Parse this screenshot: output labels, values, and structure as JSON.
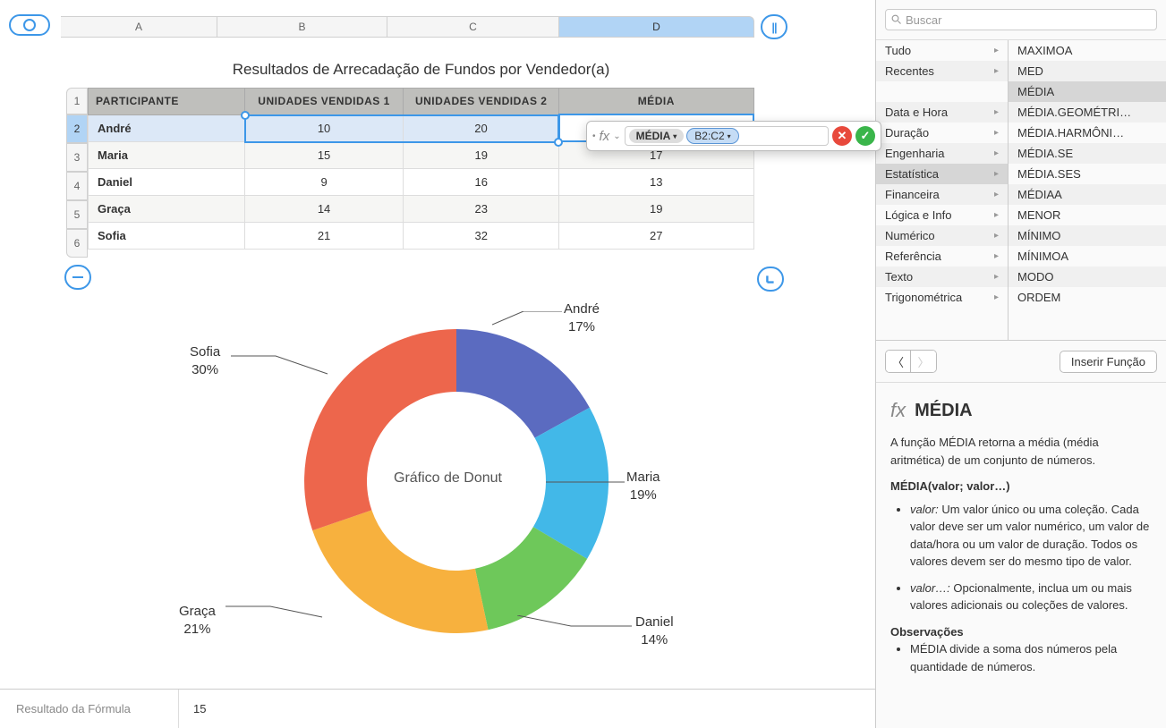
{
  "columns": {
    "A": "A",
    "B": "B",
    "C": "C",
    "D": "D"
  },
  "rows": {
    "1": "1",
    "2": "2",
    "3": "3",
    "4": "4",
    "5": "5",
    "6": "6"
  },
  "title": "Resultados de Arrecadação de Fundos por Vendedor(a)",
  "headers": {
    "participant": "PARTICIPANTE",
    "u1": "UNIDADES VENDIDAS 1",
    "u2": "UNIDADES VENDIDAS 2",
    "avg": "MÉDIA"
  },
  "table": [
    {
      "name": "André",
      "u1": "10",
      "u2": "20",
      "avg": ""
    },
    {
      "name": "Maria",
      "u1": "15",
      "u2": "19",
      "avg": "17"
    },
    {
      "name": "Daniel",
      "u1": "9",
      "u2": "16",
      "avg": "13"
    },
    {
      "name": "Graça",
      "u1": "14",
      "u2": "23",
      "avg": "19"
    },
    {
      "name": "Sofia",
      "u1": "21",
      "u2": "32",
      "avg": "27"
    }
  ],
  "formula_editor": {
    "func": "MÉDIA",
    "range": "B2:C2"
  },
  "chart_data": {
    "type": "pie",
    "title": "Gráfico de Donut",
    "categories": [
      "André",
      "Maria",
      "Daniel",
      "Graça",
      "Sofia"
    ],
    "values": [
      17,
      19,
      14,
      21,
      30
    ],
    "labels": {
      "andre_name": "André",
      "andre_pct": "17%",
      "maria_name": "Maria",
      "maria_pct": "19%",
      "daniel_name": "Daniel",
      "daniel_pct": "14%",
      "graca_name": "Graça",
      "graca_pct": "21%",
      "sofia_name": "Sofia",
      "sofia_pct": "30%"
    },
    "colors": {
      "andre": "#5b6bc0",
      "maria": "#42b8e8",
      "daniel": "#6ec85a",
      "graca": "#f7b13e",
      "sofia": "#ed664c"
    }
  },
  "bottom_bar": {
    "label": "Resultado da Fórmula",
    "value": "15"
  },
  "sidebar": {
    "search_placeholder": "Buscar",
    "categories": [
      "Tudo",
      "Recentes",
      "",
      "Data e Hora",
      "Duração",
      "Engenharia",
      "Estatística",
      "Financeira",
      "Lógica e Info",
      "Numérico",
      "Referência",
      "Texto",
      "Trigonométrica"
    ],
    "category_selected": "Estatística",
    "functions": [
      "MAXIMOA",
      "MED",
      "MÉDIA",
      "MÉDIA.GEOMÉTRI…",
      "MÉDIA.HARMÔNI…",
      "MÉDIA.SE",
      "MÉDIA.SES",
      "MÉDIAA",
      "MENOR",
      "MÍNIMO",
      "MÍNIMOA",
      "MODO",
      "ORDEM"
    ],
    "function_selected": "MÉDIA",
    "insert_button": "Inserir Função",
    "help": {
      "title": "MÉDIA",
      "desc": "A função MÉDIA retorna a média (média aritmética) de um conjunto de números.",
      "signature": "MÉDIA(valor; valor…)",
      "param1_name": "valor:",
      "param1_desc": "Um valor único ou uma coleção. Cada valor deve ser um valor numérico, um valor de data/hora ou um valor de duração. Todos os valores devem ser do mesmo tipo de valor.",
      "param2_name": "valor…:",
      "param2_desc": "Opcionalmente, inclua um ou mais valores adicionais ou coleções de valores.",
      "notes_title": "Observações",
      "note1": "MÉDIA divide a soma dos números pela quantidade de números."
    }
  }
}
